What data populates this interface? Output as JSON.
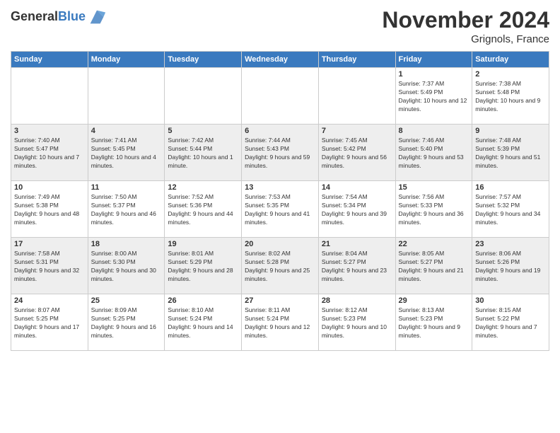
{
  "header": {
    "logo_general": "General",
    "logo_blue": "Blue",
    "month_title": "November 2024",
    "location": "Grignols, France"
  },
  "days_of_week": [
    "Sunday",
    "Monday",
    "Tuesday",
    "Wednesday",
    "Thursday",
    "Friday",
    "Saturday"
  ],
  "weeks": [
    {
      "days": [
        {
          "number": "",
          "info": ""
        },
        {
          "number": "",
          "info": ""
        },
        {
          "number": "",
          "info": ""
        },
        {
          "number": "",
          "info": ""
        },
        {
          "number": "",
          "info": ""
        },
        {
          "number": "1",
          "info": "Sunrise: 7:37 AM\nSunset: 5:49 PM\nDaylight: 10 hours and 12 minutes."
        },
        {
          "number": "2",
          "info": "Sunrise: 7:38 AM\nSunset: 5:48 PM\nDaylight: 10 hours and 9 minutes."
        }
      ]
    },
    {
      "days": [
        {
          "number": "3",
          "info": "Sunrise: 7:40 AM\nSunset: 5:47 PM\nDaylight: 10 hours and 7 minutes."
        },
        {
          "number": "4",
          "info": "Sunrise: 7:41 AM\nSunset: 5:45 PM\nDaylight: 10 hours and 4 minutes."
        },
        {
          "number": "5",
          "info": "Sunrise: 7:42 AM\nSunset: 5:44 PM\nDaylight: 10 hours and 1 minute."
        },
        {
          "number": "6",
          "info": "Sunrise: 7:44 AM\nSunset: 5:43 PM\nDaylight: 9 hours and 59 minutes."
        },
        {
          "number": "7",
          "info": "Sunrise: 7:45 AM\nSunset: 5:42 PM\nDaylight: 9 hours and 56 minutes."
        },
        {
          "number": "8",
          "info": "Sunrise: 7:46 AM\nSunset: 5:40 PM\nDaylight: 9 hours and 53 minutes."
        },
        {
          "number": "9",
          "info": "Sunrise: 7:48 AM\nSunset: 5:39 PM\nDaylight: 9 hours and 51 minutes."
        }
      ]
    },
    {
      "days": [
        {
          "number": "10",
          "info": "Sunrise: 7:49 AM\nSunset: 5:38 PM\nDaylight: 9 hours and 48 minutes."
        },
        {
          "number": "11",
          "info": "Sunrise: 7:50 AM\nSunset: 5:37 PM\nDaylight: 9 hours and 46 minutes."
        },
        {
          "number": "12",
          "info": "Sunrise: 7:52 AM\nSunset: 5:36 PM\nDaylight: 9 hours and 44 minutes."
        },
        {
          "number": "13",
          "info": "Sunrise: 7:53 AM\nSunset: 5:35 PM\nDaylight: 9 hours and 41 minutes."
        },
        {
          "number": "14",
          "info": "Sunrise: 7:54 AM\nSunset: 5:34 PM\nDaylight: 9 hours and 39 minutes."
        },
        {
          "number": "15",
          "info": "Sunrise: 7:56 AM\nSunset: 5:33 PM\nDaylight: 9 hours and 36 minutes."
        },
        {
          "number": "16",
          "info": "Sunrise: 7:57 AM\nSunset: 5:32 PM\nDaylight: 9 hours and 34 minutes."
        }
      ]
    },
    {
      "days": [
        {
          "number": "17",
          "info": "Sunrise: 7:58 AM\nSunset: 5:31 PM\nDaylight: 9 hours and 32 minutes."
        },
        {
          "number": "18",
          "info": "Sunrise: 8:00 AM\nSunset: 5:30 PM\nDaylight: 9 hours and 30 minutes."
        },
        {
          "number": "19",
          "info": "Sunrise: 8:01 AM\nSunset: 5:29 PM\nDaylight: 9 hours and 28 minutes."
        },
        {
          "number": "20",
          "info": "Sunrise: 8:02 AM\nSunset: 5:28 PM\nDaylight: 9 hours and 25 minutes."
        },
        {
          "number": "21",
          "info": "Sunrise: 8:04 AM\nSunset: 5:27 PM\nDaylight: 9 hours and 23 minutes."
        },
        {
          "number": "22",
          "info": "Sunrise: 8:05 AM\nSunset: 5:27 PM\nDaylight: 9 hours and 21 minutes."
        },
        {
          "number": "23",
          "info": "Sunrise: 8:06 AM\nSunset: 5:26 PM\nDaylight: 9 hours and 19 minutes."
        }
      ]
    },
    {
      "days": [
        {
          "number": "24",
          "info": "Sunrise: 8:07 AM\nSunset: 5:25 PM\nDaylight: 9 hours and 17 minutes."
        },
        {
          "number": "25",
          "info": "Sunrise: 8:09 AM\nSunset: 5:25 PM\nDaylight: 9 hours and 16 minutes."
        },
        {
          "number": "26",
          "info": "Sunrise: 8:10 AM\nSunset: 5:24 PM\nDaylight: 9 hours and 14 minutes."
        },
        {
          "number": "27",
          "info": "Sunrise: 8:11 AM\nSunset: 5:24 PM\nDaylight: 9 hours and 12 minutes."
        },
        {
          "number": "28",
          "info": "Sunrise: 8:12 AM\nSunset: 5:23 PM\nDaylight: 9 hours and 10 minutes."
        },
        {
          "number": "29",
          "info": "Sunrise: 8:13 AM\nSunset: 5:23 PM\nDaylight: 9 hours and 9 minutes."
        },
        {
          "number": "30",
          "info": "Sunrise: 8:15 AM\nSunset: 5:22 PM\nDaylight: 9 hours and 7 minutes."
        }
      ]
    }
  ]
}
